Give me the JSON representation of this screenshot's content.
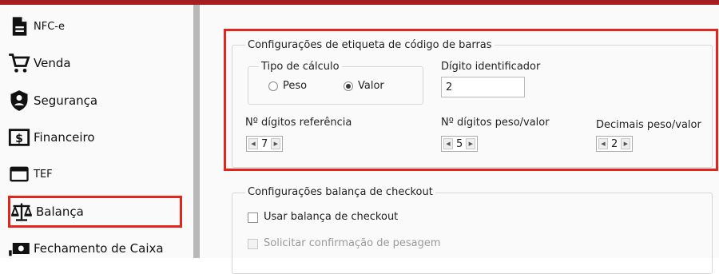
{
  "sidebar": {
    "items": [
      {
        "label": "NFC-e",
        "icon": "document-icon"
      },
      {
        "label": "Venda",
        "icon": "cart-icon"
      },
      {
        "label": "Segurança",
        "icon": "shield-user-icon"
      },
      {
        "label": "Financeiro",
        "icon": "money-icon"
      },
      {
        "label": "TEF",
        "icon": "card-icon"
      },
      {
        "label": "Balança",
        "icon": "scale-icon",
        "selected": true
      },
      {
        "label": "Fechamento de Caixa",
        "icon": "cash-register-icon"
      }
    ]
  },
  "barcode": {
    "legend": "Configurações de etiqueta de código de barras",
    "calc_type": {
      "legend": "Tipo de cálculo",
      "options": [
        {
          "label": "Peso",
          "checked": false
        },
        {
          "label": "Valor",
          "checked": true
        }
      ]
    },
    "identifier": {
      "label": "Dígito identificador",
      "value": "2"
    },
    "ref_digits": {
      "label": "Nº dígitos referência",
      "value": "7"
    },
    "weight_value_digits": {
      "label": "Nº dígitos peso/valor",
      "value": "5"
    },
    "decimals": {
      "label": "Decimais peso/valor",
      "value": "2"
    }
  },
  "checkout_scale": {
    "legend": "Configurações balança de checkout",
    "use_scale": {
      "label": "Usar balança de checkout",
      "checked": false
    },
    "confirm_weighing": {
      "label": "Solicitar confirmação de pesagem",
      "checked": false,
      "disabled": true
    }
  },
  "colors": {
    "highlight": "#e2261b",
    "topbar": "#a41d21"
  }
}
